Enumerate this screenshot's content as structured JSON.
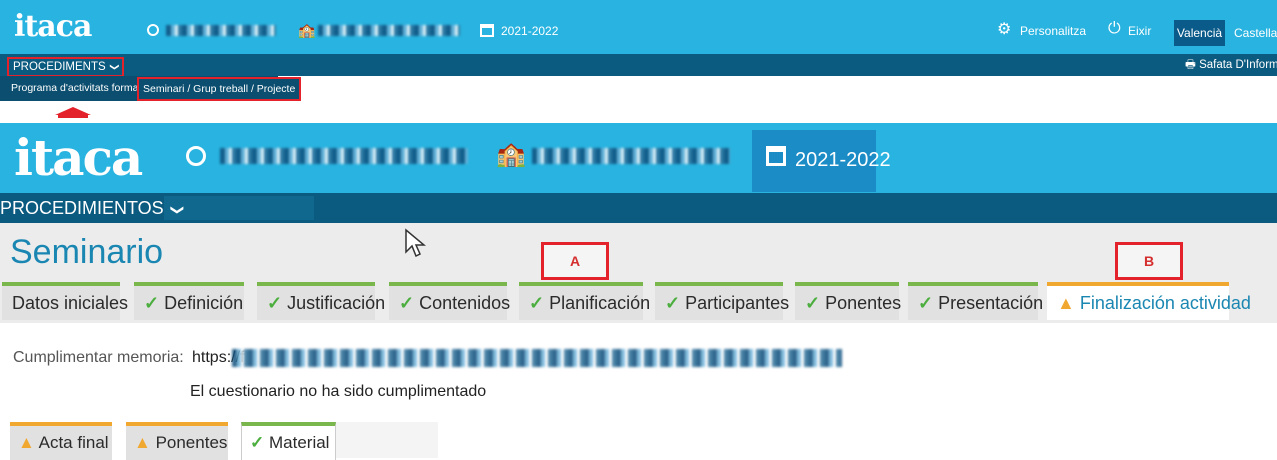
{
  "top_header": {
    "logo": "itaca",
    "year": "2021-2022",
    "personaliza": "Personalitza",
    "eixir": "Eixir",
    "lang_active": "Valencià",
    "lang_other": "Castellano",
    "procediments": "PROCEDIMENTS",
    "safata": "Safata D'Informe"
  },
  "breadcrumb": {
    "item1": "Programa d'activitats formatives",
    "item2": "Seminari / Grup treball / Projecte"
  },
  "zoom_header": {
    "logo": "itaca",
    "year": "2021-2022",
    "procedimientos": "PROCEDIMIENTOS"
  },
  "page": {
    "title": "Seminario",
    "marker_a": "A",
    "marker_b": "B"
  },
  "tabs": [
    {
      "label": "Datos iniciales",
      "status": "none"
    },
    {
      "label": "Definición",
      "status": "ok"
    },
    {
      "label": "Justificación",
      "status": "ok"
    },
    {
      "label": "Contenidos",
      "status": "ok"
    },
    {
      "label": "Planificación",
      "status": "ok"
    },
    {
      "label": "Participantes",
      "status": "ok"
    },
    {
      "label": "Ponentes",
      "status": "ok"
    },
    {
      "label": "Presentación",
      "status": "ok"
    },
    {
      "label": "Finalización actividad",
      "status": "warning"
    }
  ],
  "memoria": {
    "label": "Cumplimentar memoria:",
    "url_prefix": "https://f",
    "status": "El cuestionario no ha sido cumplimentado"
  },
  "subtabs": [
    {
      "label": "Acta final",
      "status": "warning"
    },
    {
      "label": "Ponentes",
      "status": "warning"
    },
    {
      "label": "Material",
      "status": "ok"
    }
  ],
  "icons": {
    "check": "✓",
    "warning": "▲",
    "chevron": "❯"
  },
  "colors": {
    "header_blue": "#28b3e0",
    "menu_dark": "#0b5a7f",
    "highlight_red": "#e3222b",
    "tab_ok_green": "#79b64b",
    "tab_warn_orange": "#f0a830",
    "title_blue": "#1a86b2"
  }
}
